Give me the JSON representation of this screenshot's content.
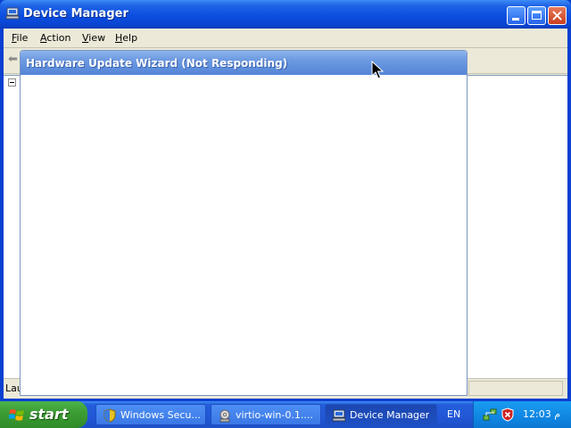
{
  "device_manager": {
    "title": "Device Manager",
    "menu": {
      "file": "File",
      "action": "Action",
      "view": "View",
      "help": "Help"
    },
    "status_text": "Lau"
  },
  "wizard": {
    "title": "Hardware Update Wizard (Not Responding)"
  },
  "taskbar": {
    "start_label": "start",
    "tasks": [
      {
        "label": "Windows Secu...",
        "icon": "shield-icon"
      },
      {
        "label": "virtio-win-0.1....",
        "icon": "cd-drive-icon"
      },
      {
        "label": "Device Manager",
        "icon": "computer-icon"
      }
    ],
    "language": "EN",
    "clock": "12:03 م"
  },
  "colors": {
    "titlebar_active": "#0a45d3",
    "titlebar_inactive": "#6f9be2",
    "start_green": "#3d9e35",
    "taskbar_blue": "#245edb"
  }
}
